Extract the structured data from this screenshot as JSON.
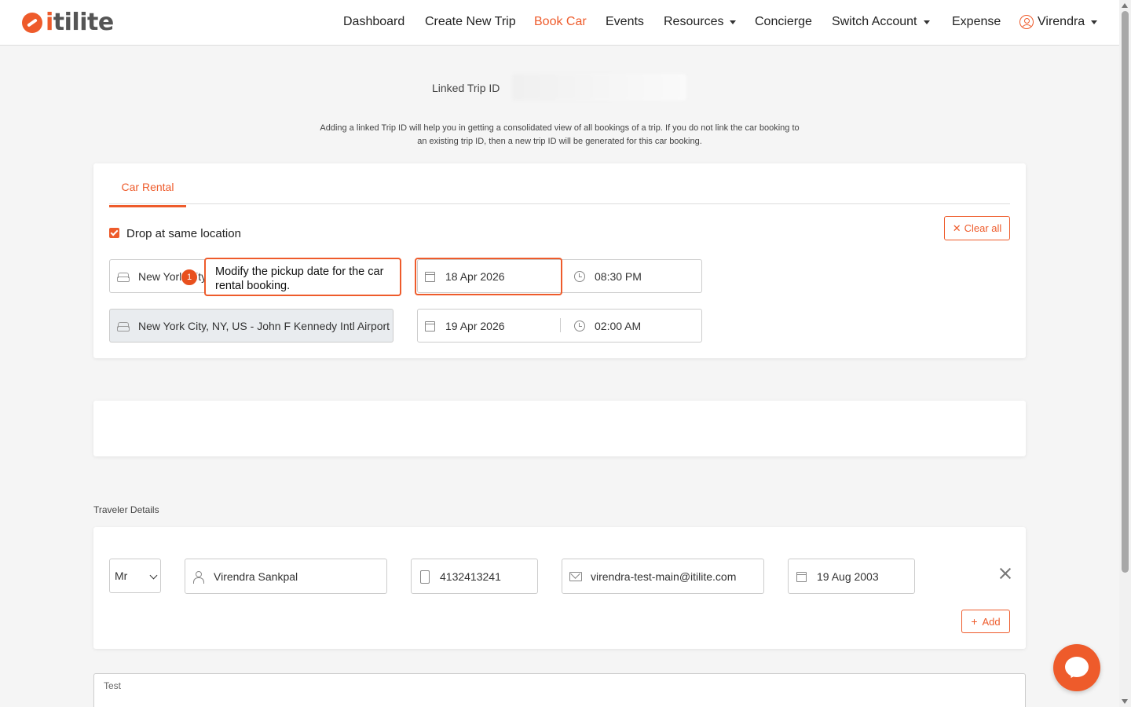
{
  "brand": {
    "name": "itilite",
    "accent_color": "#ee5b2b"
  },
  "nav": {
    "items": [
      {
        "label": "Dashboard",
        "icon": ""
      },
      {
        "label": "Create New Trip"
      },
      {
        "label": "Book Car",
        "active": true
      },
      {
        "label": "Events"
      },
      {
        "label": "Resources",
        "dropdown": true
      },
      {
        "label": "Concierge"
      },
      {
        "label": "Switch Account",
        "dropdown": true
      },
      {
        "label": "Expense"
      }
    ],
    "user": {
      "name": "Virendra",
      "icon": "user-circle-icon"
    }
  },
  "linked_trip": {
    "label": "Linked Trip ID",
    "value": "",
    "note": "Adding a linked Trip ID will help you in getting a consolidated view of all bookings of a trip. If you do not link the car booking to an existing trip ID, then a new trip ID will be generated for this car booking."
  },
  "car_rental": {
    "tab": "Car Rental",
    "same_location_label": "Drop at same location",
    "same_location_checked": true,
    "clear_all_label": "Clear all",
    "pickup": {
      "location": "New York City",
      "date": "18 Apr 2026",
      "time": "08:30 PM"
    },
    "dropoff": {
      "location": "New York City, NY, US - John F Kennedy Intl Airport (JFK)",
      "date": "19 Apr 2026",
      "time": "02:00 AM"
    }
  },
  "tooltip": {
    "step": "1",
    "text": "Modify the pickup date for the car rental booking."
  },
  "traveler": {
    "section_label": "Traveler Details",
    "title": "Mr",
    "name": "Virendra Sankpal",
    "phone": "4132413241",
    "email": "virendra-test-main@itilite.com",
    "dob": "19 Aug 2003",
    "add_label": "Add"
  },
  "notes": {
    "label": "Test"
  }
}
